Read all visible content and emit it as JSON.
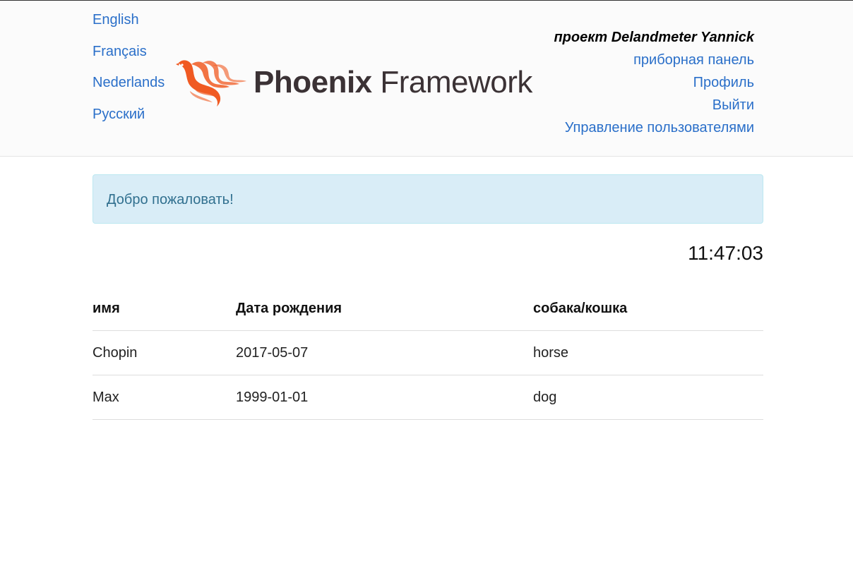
{
  "languages": [
    "English",
    "Français",
    "Nederlands",
    "Русский"
  ],
  "logo": {
    "bold": "Phoenix",
    "light": " Framework",
    "brand_color": "#f05a22"
  },
  "user_nav": {
    "project": "проект Delandmeter Yannick",
    "links": [
      "приборная панель",
      "Профиль",
      "Выйти",
      "Управление пользователями"
    ]
  },
  "alert": {
    "message": "Добро пожаловать!"
  },
  "clock": "11:47:03",
  "table": {
    "headers": [
      "имя",
      "Дата рождения",
      "собака/кошка"
    ],
    "rows": [
      [
        "Chopin",
        "2017-05-07",
        "horse"
      ],
      [
        "Max",
        "1999-01-01",
        "dog"
      ]
    ]
  },
  "colors": {
    "link": "#2a6fc9",
    "alert_bg": "#d9edf7",
    "alert_text": "#31708f"
  }
}
